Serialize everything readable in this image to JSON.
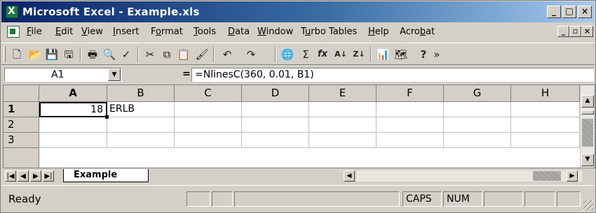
{
  "window": {
    "title": "Microsoft Excel - Example.xls",
    "minimize": "_",
    "maximize": "□",
    "close": "×"
  },
  "menu": {
    "items": [
      {
        "label": "File",
        "underline": "F"
      },
      {
        "label": "Edit",
        "underline": "E"
      },
      {
        "label": "View",
        "underline": "V"
      },
      {
        "label": "Insert",
        "underline": "I"
      },
      {
        "label": "Format",
        "underline": "o"
      },
      {
        "label": "Tools",
        "underline": "T"
      },
      {
        "label": "Data",
        "underline": "D"
      },
      {
        "label": "Window",
        "underline": "W"
      },
      {
        "label": "Turbo Tables",
        "underline": "u"
      },
      {
        "label": "Help",
        "underline": "H"
      },
      {
        "label": "Acrobat",
        "underline": "b"
      }
    ],
    "doc_minimize": "_",
    "doc_restore": "▫",
    "doc_close": "×"
  },
  "toolbar": {
    "buttons": [
      {
        "icon": "new-icon",
        "glyph": "🗋"
      },
      {
        "icon": "open-icon",
        "glyph": "📂"
      },
      {
        "icon": "save-icon",
        "glyph": "💾"
      },
      {
        "icon": "permission-icon",
        "glyph": "🖫"
      },
      {
        "icon": "print-icon",
        "glyph": "🖶"
      },
      {
        "icon": "print-preview-icon",
        "glyph": "🔍"
      },
      {
        "icon": "spelling-icon",
        "glyph": "✓"
      },
      {
        "icon": "cut-icon",
        "glyph": "✂"
      },
      {
        "icon": "copy-icon",
        "glyph": "⧉"
      },
      {
        "icon": "paste-icon",
        "glyph": "📋"
      },
      {
        "icon": "format-painter-icon",
        "glyph": "🖌"
      },
      {
        "icon": "undo-icon",
        "glyph": "↶"
      },
      {
        "icon": "redo-icon",
        "glyph": "↷"
      },
      {
        "icon": "hyperlink-icon",
        "glyph": "🌐"
      },
      {
        "icon": "autosum-icon",
        "glyph": "Σ"
      },
      {
        "icon": "function-icon",
        "glyph": "fx"
      },
      {
        "icon": "sort-ascending-icon",
        "glyph": "A↓"
      },
      {
        "icon": "sort-descending-icon",
        "glyph": "Z↓"
      },
      {
        "icon": "chart-wizard-icon",
        "glyph": "📊"
      },
      {
        "icon": "map-icon",
        "glyph": "🗺"
      },
      {
        "icon": "help-icon",
        "glyph": "?"
      },
      {
        "icon": "more-icon",
        "glyph": "»"
      }
    ]
  },
  "formula_bar": {
    "name_box": "A1",
    "equals": "=",
    "formula": "=NlinesC(360, 0.01, B1)"
  },
  "grid": {
    "columns": [
      "A",
      "B",
      "C",
      "D",
      "E",
      "F",
      "G",
      "H"
    ],
    "rows": [
      "1",
      "2",
      "3"
    ],
    "active_cell": "A1",
    "cells": {
      "A1": "18",
      "B1": "ERLB"
    }
  },
  "sheets": {
    "tabs": [
      "Example"
    ],
    "active": "Example"
  },
  "status": {
    "text": "Ready",
    "caps": "CAPS",
    "num": "NUM"
  }
}
